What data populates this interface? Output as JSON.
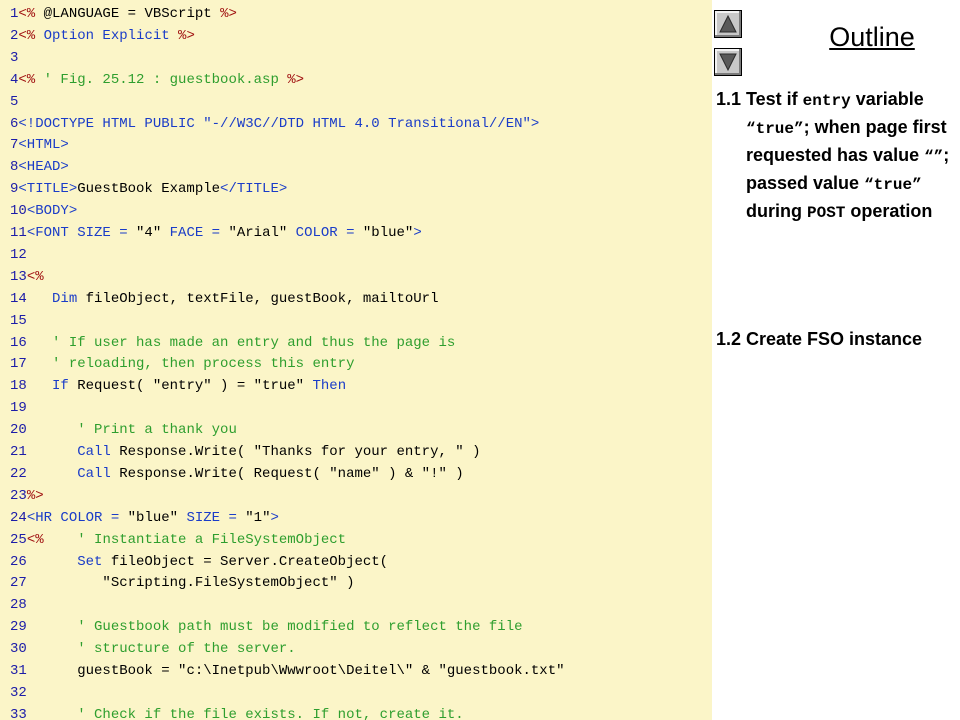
{
  "code_lines": [
    [
      [
        "1",
        "num"
      ],
      [
        "<% ",
        "dl"
      ],
      [
        "@LANGUAGE = VBScript ",
        "tx"
      ],
      [
        "%>",
        "dl"
      ]
    ],
    [
      [
        "2",
        "num"
      ],
      [
        "<% ",
        "dl"
      ],
      [
        "Option Explicit ",
        "kw"
      ],
      [
        "%>",
        "dl"
      ]
    ],
    [
      [
        "3",
        "num"
      ]
    ],
    [
      [
        "4",
        "num"
      ],
      [
        "<% ",
        "dl"
      ],
      [
        "' Fig. 25.12 : guestbook.asp ",
        "cm"
      ],
      [
        "%>",
        "dl"
      ]
    ],
    [
      [
        "5",
        "num"
      ]
    ],
    [
      [
        "6",
        "num"
      ],
      [
        "<!DOCTYPE HTML PUBLIC ",
        "kw"
      ],
      [
        "\"-//W3C//DTD HTML 4.0 Transitional//EN\"",
        "kw"
      ],
      [
        ">",
        "kw"
      ]
    ],
    [
      [
        "7",
        "num"
      ],
      [
        "<HTML>",
        "kw"
      ]
    ],
    [
      [
        "8",
        "num"
      ],
      [
        "<HEAD>",
        "kw"
      ]
    ],
    [
      [
        "9",
        "num"
      ],
      [
        "<TITLE>",
        "kw"
      ],
      [
        "GuestBook Example",
        "tx"
      ],
      [
        "</TITLE>",
        "kw"
      ]
    ],
    [
      [
        "10",
        "num"
      ],
      [
        "<BODY>",
        "kw"
      ]
    ],
    [
      [
        "11",
        "num"
      ],
      [
        "<FONT SIZE = ",
        "kw"
      ],
      [
        "\"4\"",
        "tx"
      ],
      [
        " FACE = ",
        "kw"
      ],
      [
        "\"Arial\"",
        "tx"
      ],
      [
        " COLOR = ",
        "kw"
      ],
      [
        "\"blue\"",
        "tx"
      ],
      [
        ">",
        "kw"
      ]
    ],
    [
      [
        "12",
        "num"
      ]
    ],
    [
      [
        "13",
        "num"
      ],
      [
        "<%",
        "dl"
      ]
    ],
    [
      [
        "14",
        "num"
      ],
      [
        "   Dim ",
        "kw"
      ],
      [
        "fileObject, textFile, guestBook, mailtoUrl",
        "tx"
      ]
    ],
    [
      [
        "15",
        "num"
      ]
    ],
    [
      [
        "16",
        "num"
      ],
      [
        "   ' If user has made an entry and thus the page is",
        "cm"
      ]
    ],
    [
      [
        "17",
        "num"
      ],
      [
        "   ' reloading, then process this entry",
        "cm"
      ]
    ],
    [
      [
        "18",
        "num"
      ],
      [
        "   If ",
        "kw"
      ],
      [
        "Request( \"entry\" ) = \"true\" ",
        "tx"
      ],
      [
        "Then",
        "kw"
      ]
    ],
    [
      [
        "19",
        "num"
      ]
    ],
    [
      [
        "20",
        "num"
      ],
      [
        "      ' Print a thank you",
        "cm"
      ]
    ],
    [
      [
        "21",
        "num"
      ],
      [
        "      Call ",
        "kw"
      ],
      [
        "Response.Write( \"Thanks for your entry, \" )",
        "tx"
      ]
    ],
    [
      [
        "22",
        "num"
      ],
      [
        "      Call ",
        "kw"
      ],
      [
        "Response.Write( Request( \"name\" ) & \"!\" )",
        "tx"
      ]
    ],
    [
      [
        "23",
        "num"
      ],
      [
        "%>",
        "dl"
      ]
    ],
    [
      [
        "24",
        "num"
      ],
      [
        "<HR COLOR = ",
        "kw"
      ],
      [
        "\"blue\"",
        "tx"
      ],
      [
        " SIZE = ",
        "kw"
      ],
      [
        "\"1\"",
        "tx"
      ],
      [
        ">",
        "kw"
      ]
    ],
    [
      [
        "25",
        "num"
      ],
      [
        "<% ",
        "dl"
      ],
      [
        "   ' Instantiate a FileSystemObject",
        "cm"
      ]
    ],
    [
      [
        "26",
        "num"
      ],
      [
        "      Set ",
        "kw"
      ],
      [
        "fileObject = Server.CreateObject(",
        "tx"
      ]
    ],
    [
      [
        "27",
        "num"
      ],
      [
        "         \"Scripting.FileSystemObject\" )",
        "tx"
      ]
    ],
    [
      [
        "28",
        "num"
      ]
    ],
    [
      [
        "29",
        "num"
      ],
      [
        "      ' Guestbook path must be modified to reflect the file",
        "cm"
      ]
    ],
    [
      [
        "30",
        "num"
      ],
      [
        "      ' structure of the server.",
        "cm"
      ]
    ],
    [
      [
        "31",
        "num"
      ],
      [
        "      guestBook = \"c:\\Inetpub\\Wwwroot\\Deitel\\\" & \"guestbook.txt\"",
        "tx"
      ]
    ],
    [
      [
        "32",
        "num"
      ]
    ],
    [
      [
        "33",
        "num"
      ],
      [
        "      ' Check if the file exists. If not, create it.",
        "cm"
      ]
    ]
  ],
  "outline": {
    "title": "Outline",
    "items": [
      {
        "number": "1.1",
        "parts": [
          [
            "Test if ",
            "t"
          ],
          [
            "entry",
            "m"
          ],
          [
            " variable ",
            "t"
          ],
          [
            "“true”",
            "m"
          ],
          [
            "; when page first requested has value ",
            "t"
          ],
          [
            "“”",
            "m"
          ],
          [
            "; passed value ",
            "t"
          ],
          [
            "“true”",
            "m"
          ],
          [
            " during ",
            "t"
          ],
          [
            "POST",
            "m"
          ],
          [
            " operation",
            "t"
          ]
        ]
      },
      {
        "number": "1.2",
        "parts": [
          [
            "Create FSO instance",
            "t"
          ]
        ]
      }
    ]
  },
  "icons": {
    "up": "triangle-up-icon",
    "down": "triangle-down-icon"
  }
}
